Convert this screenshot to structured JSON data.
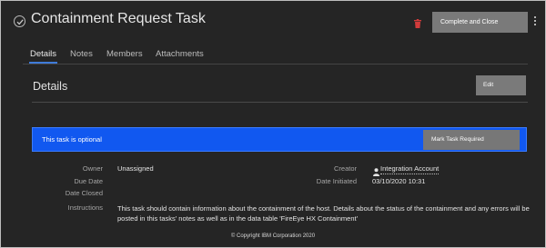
{
  "header": {
    "title": "Containment Request Task",
    "complete_label": "Complete and Close",
    "accent_delete_color": "#d23b3b"
  },
  "tabs": [
    {
      "label": "Details",
      "active": true
    },
    {
      "label": "Notes",
      "active": false
    },
    {
      "label": "Members",
      "active": false
    },
    {
      "label": "Attachments",
      "active": false
    }
  ],
  "section": {
    "title": "Details",
    "edit_label": "Edit"
  },
  "banner": {
    "text": "This task is optional",
    "button_label": "Mark Task Required",
    "color": "#1158f0"
  },
  "fields": {
    "owner_label": "Owner",
    "owner_value": "Unassigned",
    "due_date_label": "Due Date",
    "date_closed_label": "Date Closed",
    "creator_label": "Creator",
    "creator_value": "Integration Account",
    "date_initiated_label": "Date Initiated",
    "date_initiated_value": "03/10/2020 10:31",
    "instructions_label": "Instructions",
    "instructions_value": "This task should contain information about the containment of the host. Details about the status of the containment and any errors will be posted in this tasks' notes as well as in the data table 'FireEye HX Containment'"
  },
  "footer": {
    "copyright": "© Copyright IBM Corporation 2020"
  }
}
